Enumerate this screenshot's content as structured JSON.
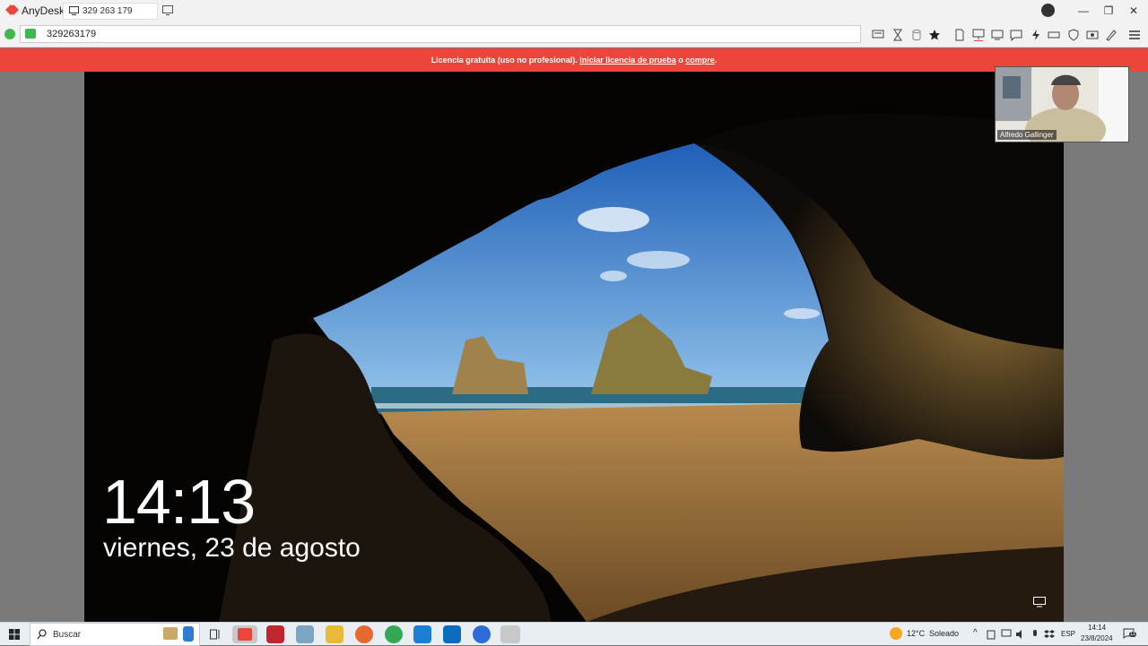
{
  "window": {
    "app_title": "AnyDesk",
    "session_tab": "329 263 179",
    "address": "329263179",
    "account_icon": "account-icon",
    "controls": [
      "—",
      "❐",
      "✕"
    ]
  },
  "banner": {
    "text_before": "Licencia gratuita (uso no profesional).",
    "link1": "Iniciar licencia de prueba",
    "middle": " o ",
    "link2": "compre",
    "end": "."
  },
  "lockscreen": {
    "time": "14:13",
    "date": "viernes, 23 de agosto"
  },
  "camera": {
    "name": "Alfredo Gallinger"
  },
  "taskbar": {
    "search_placeholder": "Buscar",
    "weather_temp": "12°C",
    "weather_desc": "Soleado",
    "language": "ESP",
    "time": "14:14",
    "date": "23/8/2024",
    "notifications": "11"
  },
  "colors": {
    "banner": "#ef443b",
    "anydesk_brand": "#ef443b",
    "online": "#3fb94e"
  }
}
